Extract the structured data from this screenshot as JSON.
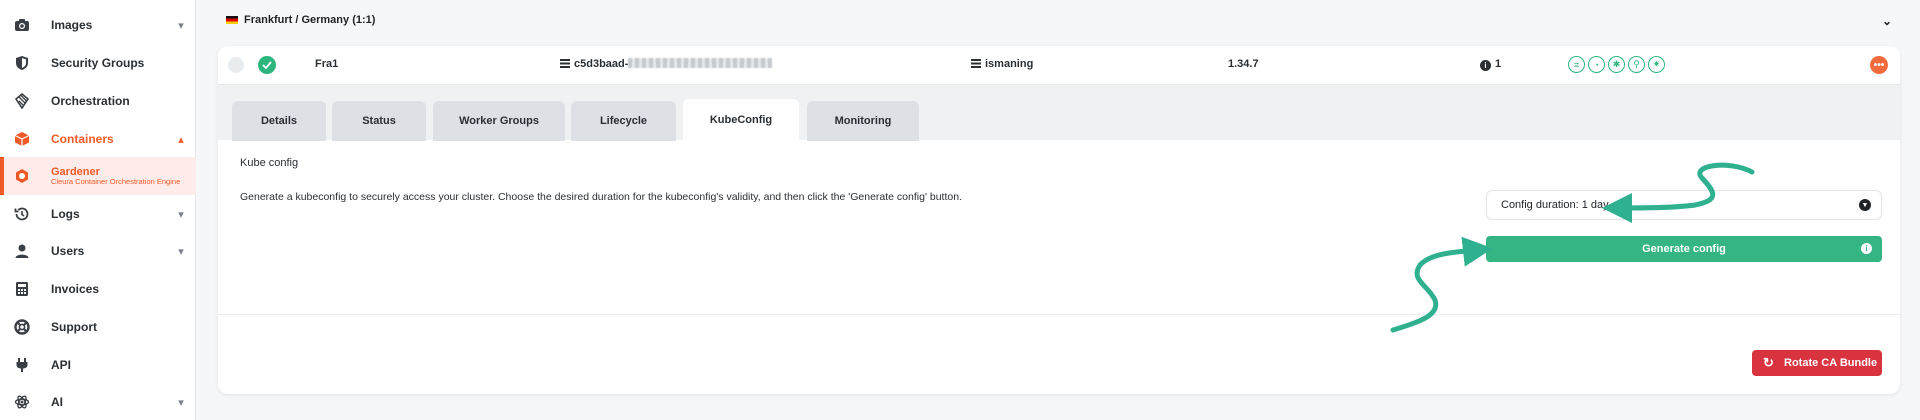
{
  "sidebar": {
    "items": [
      {
        "label": "Images",
        "icon": "camera-icon",
        "chevron": "▾"
      },
      {
        "label": "Security Groups",
        "icon": "shield-icon"
      },
      {
        "label": "Orchestration",
        "icon": "orchestration-icon"
      },
      {
        "label": "Containers",
        "icon": "box-icon",
        "chevron": "▴"
      },
      {
        "label": "Logs",
        "icon": "history-icon",
        "chevron": "▾"
      },
      {
        "label": "Users",
        "icon": "user-icon",
        "chevron": "▾"
      },
      {
        "label": "Invoices",
        "icon": "calculator-icon"
      },
      {
        "label": "Support",
        "icon": "lifebuoy-icon"
      },
      {
        "label": "API",
        "icon": "plug-icon"
      },
      {
        "label": "AI",
        "icon": "ai-icon",
        "chevron": "▾"
      }
    ],
    "sub_item": {
      "title": "Gardener",
      "subtitle": "Cleura Container Orchestration Engine",
      "icon": "gardener-icon"
    }
  },
  "region": {
    "label": "Frankfurt / Germany (1:1)",
    "chevron": "⌄"
  },
  "cluster": {
    "name": "Fra1",
    "id_prefix": "c5d3baad-",
    "project": "ismaning",
    "version": "1.34.7",
    "info_count": "1",
    "status_icons": [
      "list-icon",
      "gauge-icon",
      "nodes-icon",
      "hierarchy-icon",
      "settings-icon"
    ],
    "more_label": "•••"
  },
  "tabs": [
    {
      "label": "Details"
    },
    {
      "label": "Status"
    },
    {
      "label": "Worker Groups"
    },
    {
      "label": "Lifecycle"
    },
    {
      "label": "KubeConfig",
      "active": true
    },
    {
      "label": "Monitoring"
    }
  ],
  "kubeconfig": {
    "title": "Kube config",
    "description": "Generate a kubeconfig to securely access your cluster. Choose the desired duration for the kubeconfig's validity, and then click the 'Generate config' button.",
    "duration_label": "Config duration: 1 day",
    "generate_label": "Generate config",
    "rotate_label": "Rotate CA Bundle"
  },
  "colors": {
    "accent": "#f05a28",
    "success": "#35b583",
    "danger": "#d9333f",
    "arrow": "#2fb08f"
  }
}
